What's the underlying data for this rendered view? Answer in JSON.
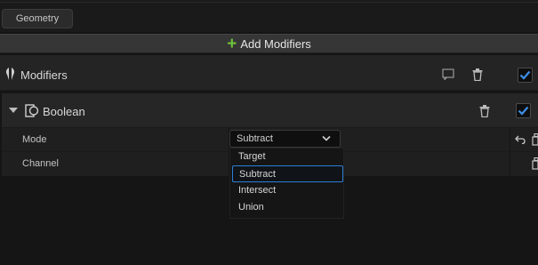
{
  "geometry_button": {
    "label": "Geometry"
  },
  "add_modifiers": {
    "label": "Add Modifiers"
  },
  "modifiers": {
    "title": "Modifiers",
    "enabled": true
  },
  "boolean_modifier": {
    "title": "Boolean",
    "enabled": true,
    "expanded": true,
    "properties": [
      {
        "label": "Mode",
        "value": "Subtract"
      },
      {
        "label": "Channel",
        "value": ""
      }
    ]
  },
  "mode_dropdown": {
    "selected": "Subtract",
    "options": [
      "Target",
      "Subtract",
      "Intersect",
      "Union"
    ]
  },
  "colors": {
    "accent_blue": "#2e7fd6",
    "add_green": "#6fc23a",
    "checkbox_blue": "#3d8fe8"
  }
}
